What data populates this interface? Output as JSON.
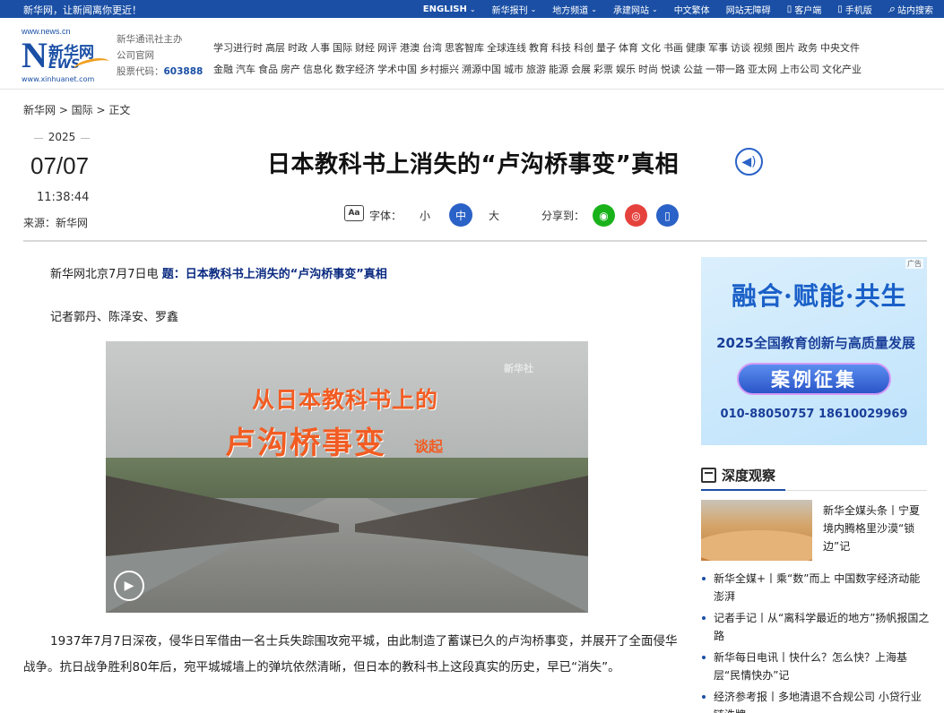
{
  "topbar": {
    "slogan": "新华网，让新闻离你更近！",
    "nav": [
      {
        "label": "ENGLISH",
        "caret": true
      },
      {
        "label": "新华报刊",
        "caret": true
      },
      {
        "label": "地方频道",
        "caret": true
      },
      {
        "label": "承建网站",
        "caret": true
      },
      {
        "label": "中文繁体",
        "caret": false
      },
      {
        "label": "网站无障碍",
        "caret": false
      },
      {
        "label": "客户端",
        "icon": "phone-icon"
      },
      {
        "label": "手机版",
        "icon": "mobile-icon"
      },
      {
        "label": "站内搜索",
        "icon": "search-icon"
      }
    ],
    "colors": {
      "bar": "#1a4fa5"
    }
  },
  "logo": {
    "top": "www.news.cn",
    "cn": "新华网",
    "n": "N",
    "ews": "EWS",
    "url": "www.xinhuanet.com"
  },
  "corp": {
    "line1": "新华通讯社主办",
    "line2": "公司官网",
    "stock_label": "股票代码：",
    "stock_code": "603888"
  },
  "channels": {
    "row1": [
      "学习进行时",
      "高层",
      "时政",
      "人事",
      "国际",
      "财经",
      "网评",
      "港澳",
      "台湾",
      "思客智库",
      "全球连线",
      "教育",
      "科技",
      "科创",
      "量子",
      "体育",
      "文化",
      "书画",
      "健康",
      "军事",
      "访谈",
      "视频",
      "图片",
      "政务",
      "中央文件"
    ],
    "row2": [
      "金融",
      "汽车",
      "食品",
      "房产",
      "信息化",
      "数字经济",
      "学术中国",
      "乡村振兴",
      "溯源中国",
      "城市",
      "旅游",
      "能源",
      "会展",
      "彩票",
      "娱乐",
      "时尚",
      "悦读",
      "公益",
      "一带一路",
      "亚太网",
      "上市公司",
      "文化产业"
    ]
  },
  "breadcrumb": "新华网 > 国际 > 正文",
  "date": {
    "year": "2025",
    "md": "07/07",
    "time": "11:38:44",
    "source": "来源：新华网"
  },
  "title": "日本教科书上消失的“卢沟桥事变”真相",
  "tools": {
    "aa": "Aa",
    "font_label": "字体：",
    "small": "小",
    "medium": "中",
    "large": "大",
    "share_label": "分享到："
  },
  "article": {
    "lead_prefix": "新华网北京7月7日电 ",
    "lead_title": "题：日本教科书上消失的“卢沟桥事变”真相",
    "reporters": "记者郭丹、陈泽安、罗鑫",
    "photo": {
      "watermark": "新华社",
      "line1": "从日本教科书上的",
      "line2": "卢沟桥事变",
      "line3": "谈起"
    },
    "body": "1937年7月7日深夜，侵华日军借由一名士兵失踪围攻宛平城，由此制造了蓄谋已久的卢沟桥事变，并展开了全面侵华战争。抗日战争胜利80年后，宛平城城墙上的弹坑依然清晰，但日本的教科书上这段真实的历史，早已“消失”。"
  },
  "ad": {
    "tag": "广告",
    "headline": "融合·赋能·共生",
    "sub": "2025全国教育创新与高质量发展",
    "button": "案例征集",
    "tel": "010-88050757  18610029969"
  },
  "sidebar": {
    "section_title": "深度观察",
    "feature": "新华全媒头条丨宁夏境内腾格里沙漠“锁边”记",
    "news": [
      "新华全媒+丨乘“数”而上 中国数字经济动能澎湃",
      "记者手记丨从“离科学最近的地方”扬帆报国之路",
      "新华每日电讯丨快什么？怎么快？上海基层“民情快办”记",
      "经济参考报丨多地清退不合规公司 小贷行业链洗牌"
    ]
  }
}
